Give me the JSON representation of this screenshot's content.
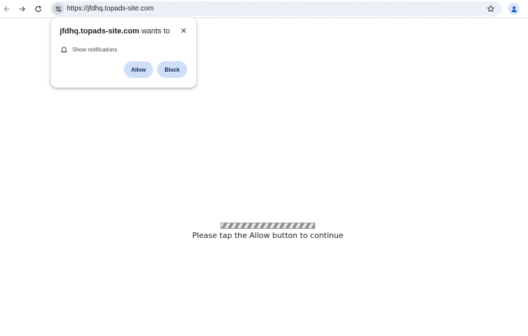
{
  "browser": {
    "url": "https://jfdhq.topads-site.com",
    "icons": {
      "back": "back-arrow-icon",
      "forward": "forward-arrow-icon",
      "reload": "reload-icon",
      "site_info": "tune-icon",
      "bookmark": "star-icon",
      "profile": "person-icon"
    }
  },
  "permission_prompt": {
    "site": "jfdhq.topads-site.com",
    "wants_to": " wants to",
    "permission_label": "Show notifications",
    "allow_label": "Allow",
    "block_label": "Block",
    "icons": {
      "permission": "bell-icon",
      "close": "close-icon"
    }
  },
  "page": {
    "message": "Please tap the Allow button to continue"
  },
  "colors": {
    "button_bg": "#c9daf8",
    "omnibox_bg": "#e9eef6"
  }
}
